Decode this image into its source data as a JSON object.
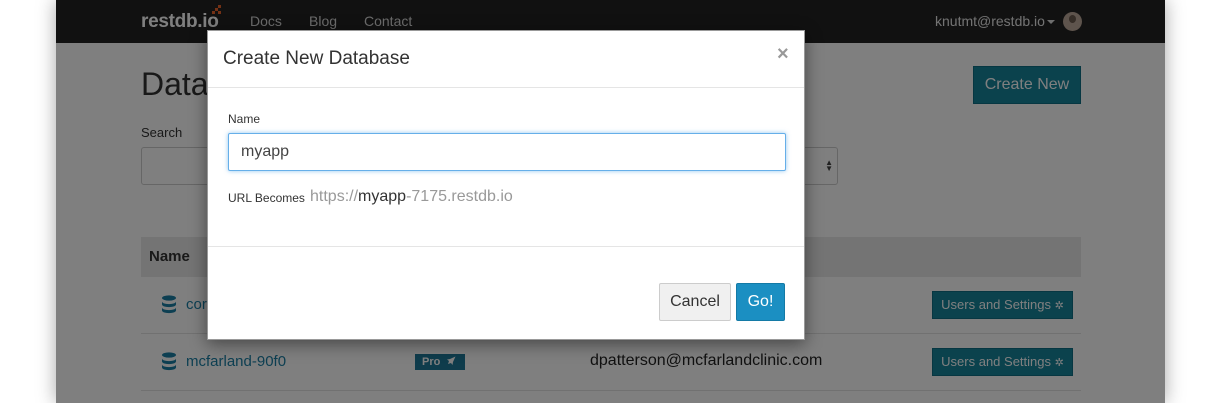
{
  "navbar": {
    "brand": "restdb.io",
    "links": [
      "Docs",
      "Blog",
      "Contact"
    ],
    "user": "knutmt@restdb.io"
  },
  "page": {
    "title": "Data",
    "create_new_label": "Create New",
    "search_label": "Search"
  },
  "table": {
    "header_name": "Name",
    "rows": [
      {
        "name": "cor",
        "plan": "",
        "owner": "",
        "action": "Users and Settings"
      },
      {
        "name": "mcfarland-90f0",
        "plan": "Pro",
        "owner": "dpatterson@mcfarlandclinic.com",
        "action": "Users and Settings"
      }
    ]
  },
  "modal": {
    "title": "Create New Database",
    "close_glyph": "×",
    "name_label": "Name",
    "name_value": "myapp",
    "url_label": "URL Becomes",
    "url_prefix": "https://",
    "url_name": "myapp",
    "url_suffix": "-7175.restdb.io",
    "cancel_label": "Cancel",
    "go_label": "Go!"
  },
  "colors": {
    "navbar": "#222222",
    "accent": "#16849b",
    "go_button": "#1b8fc2",
    "brand_mark": "#e8632b"
  },
  "icons": [
    "database-icon",
    "rocket-icon",
    "gear-icon",
    "close-icon",
    "caret-down-icon",
    "sort-arrows-icon"
  ]
}
